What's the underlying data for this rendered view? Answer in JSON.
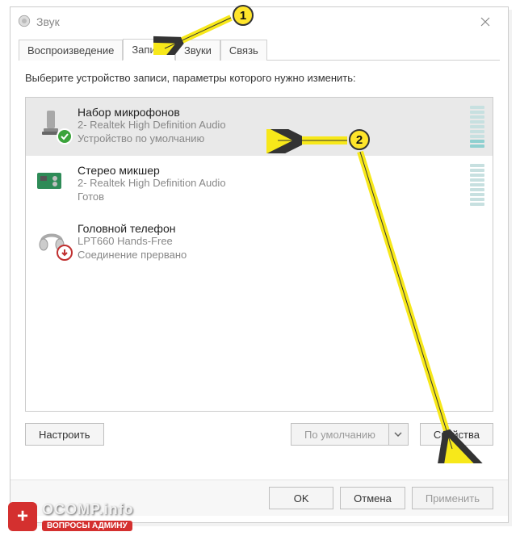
{
  "window": {
    "title": "Звук"
  },
  "tabs": [
    "Воспроизведение",
    "Запись",
    "Звуки",
    "Связь"
  ],
  "active_tab_index": 1,
  "instruction": "Выберите устройство записи, параметры которого нужно изменить:",
  "devices": [
    {
      "name": "Набор микрофонов",
      "line2": "2- Realtek High Definition Audio",
      "line3": "Устройство по умолчанию",
      "status": "default",
      "level_bars_total": 9,
      "level_bars_active": 2,
      "selected": true
    },
    {
      "name": "Стерео микшер",
      "line2": "2- Realtek High Definition Audio",
      "line3": "Готов",
      "status": "ready",
      "level_bars_total": 9,
      "level_bars_active": 0,
      "selected": false
    },
    {
      "name": "Головной телефон",
      "line2": "LPT660 Hands-Free",
      "line3": "Соединение прервано",
      "status": "disconnected",
      "level_bars_total": 0,
      "level_bars_active": 0,
      "selected": false
    }
  ],
  "buttons": {
    "configure": "Настроить",
    "set_default": "По умолчанию",
    "properties": "Свойства",
    "ok": "OK",
    "cancel": "Отмена",
    "apply": "Применить"
  },
  "annotations": {
    "badge1": "1",
    "badge2": "2"
  },
  "watermark": {
    "main": "OCOMP.info",
    "sub": "ВОПРОСЫ АДМИНУ",
    "icon": "+"
  }
}
